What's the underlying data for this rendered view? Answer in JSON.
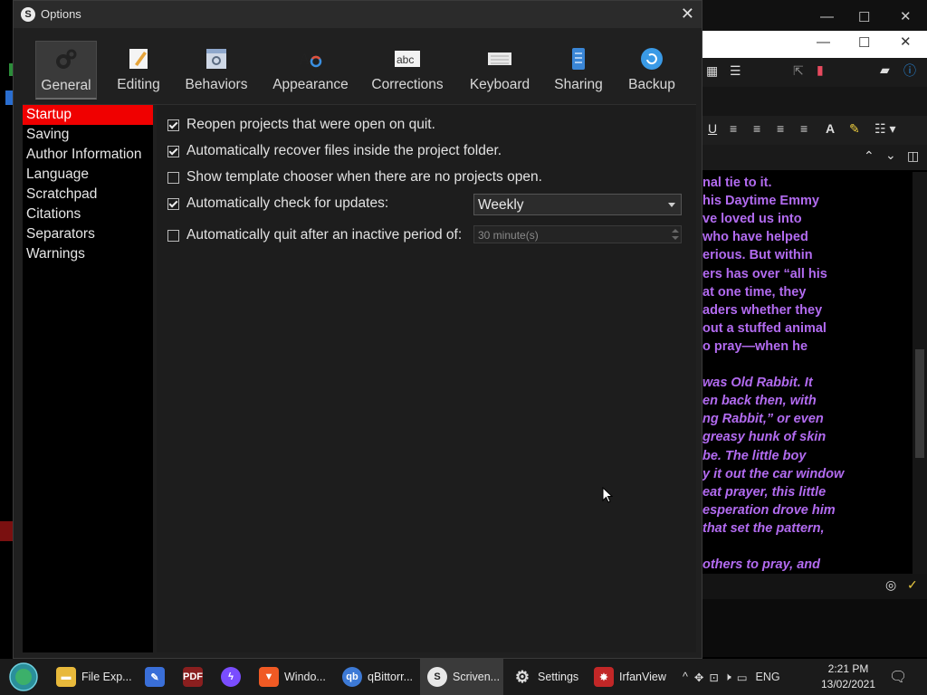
{
  "dialog": {
    "title": "Options",
    "tabs": [
      {
        "label": "General",
        "icon": "gears-icon"
      },
      {
        "label": "Editing",
        "icon": "pencil-icon"
      },
      {
        "label": "Behaviors",
        "icon": "settings-window-icon"
      },
      {
        "label": "Appearance",
        "icon": "font-color-icon"
      },
      {
        "label": "Corrections",
        "icon": "abc-icon"
      },
      {
        "label": "Keyboard",
        "icon": "keyboard-icon"
      },
      {
        "label": "Sharing",
        "icon": "sharing-icon"
      },
      {
        "label": "Backup",
        "icon": "backup-icon"
      }
    ],
    "active_tab": "General",
    "sidebar": [
      "Startup",
      "Saving",
      "Author Information",
      "Language",
      "Scratchpad",
      "Citations",
      "Separators",
      "Warnings"
    ],
    "selected_sidebar": "Startup",
    "options": [
      {
        "label": "Reopen projects that were open on quit.",
        "checked": true
      },
      {
        "label": "Automatically recover files inside the project folder.",
        "checked": true
      },
      {
        "label": "Show template chooser when there are no projects open.",
        "checked": false
      },
      {
        "label": "Automatically check for updates:",
        "checked": true
      },
      {
        "label": "Automatically quit after an inactive period of:",
        "checked": false
      }
    ],
    "update_frequency": "Weekly",
    "inactive_period": "30 minute(s)"
  },
  "editor_text": [
    "nal tie to it.",
    " his Daytime Emmy",
    "ve loved us into",
    " who have helped",
    "erious. But within",
    "ers has over “all his",
    " at one time, they",
    "aders whether they",
    "out a stuffed animal",
    "o pray—when he",
    "",
    " was Old Rabbit. It",
    "en back then, with",
    "ng Rabbit,” or even",
    "greasy hunk of skin",
    "be. The little boy",
    "y it out the car window",
    "eat prayer, this little",
    "esperation drove him",
    "that set the pattern,",
    "",
    "others to pray, and"
  ],
  "taskbar": {
    "items": [
      {
        "label": "File Exp...",
        "icon": "folder-icon",
        "color": "#e8b93b"
      },
      {
        "label": "",
        "icon": "notepad-icon",
        "color": "#3a6fd8"
      },
      {
        "label": "",
        "icon": "pdf-icon",
        "color": "#8a1f1f"
      },
      {
        "label": "",
        "icon": "messenger-icon",
        "color": "#7a4dff"
      },
      {
        "label": "Windo...",
        "icon": "brave-icon",
        "color": "#f05a24"
      },
      {
        "label": "qBittorr...",
        "icon": "qbittorrent-icon",
        "color": "#3d7ad6"
      },
      {
        "label": "Scriven...",
        "icon": "scrivener-icon",
        "color": "#e8e8e8"
      },
      {
        "label": "Settings",
        "icon": "gear-icon",
        "color": "#cccccc"
      },
      {
        "label": "IrfanView",
        "icon": "irfanview-icon",
        "color": "#c22727"
      }
    ],
    "language": "ENG",
    "time": "2:21 PM",
    "date": "13/02/2021"
  }
}
